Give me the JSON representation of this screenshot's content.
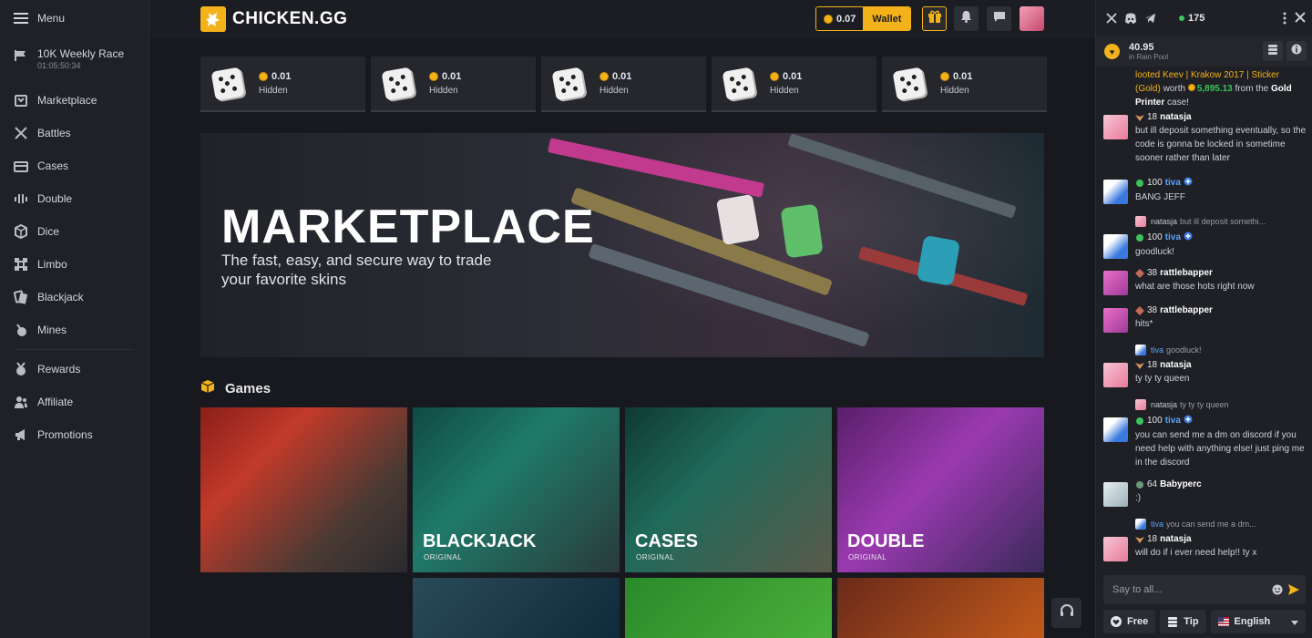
{
  "sidebar": {
    "menu_label": "Menu",
    "race": {
      "title": "10K Weekly Race",
      "timer": "01:05:50:34"
    },
    "nav": [
      {
        "label": "Marketplace",
        "icon": "store-icon"
      },
      {
        "label": "Battles",
        "icon": "swords-icon"
      },
      {
        "label": "Cases",
        "icon": "case-icon"
      },
      {
        "label": "Double",
        "icon": "bars-icon"
      },
      {
        "label": "Dice",
        "icon": "cube-icon"
      },
      {
        "label": "Limbo",
        "icon": "limbo-icon"
      },
      {
        "label": "Blackjack",
        "icon": "cards-icon"
      },
      {
        "label": "Mines",
        "icon": "mine-icon"
      }
    ],
    "secondary": [
      {
        "label": "Rewards",
        "icon": "medal-icon"
      },
      {
        "label": "Affiliate",
        "icon": "users-icon"
      },
      {
        "label": "Promotions",
        "icon": "megaphone-icon"
      }
    ]
  },
  "header": {
    "brand": "CHICKEN.GG",
    "balance": "0.07",
    "wallet_label": "Wallet",
    "accent": "#f3b21a"
  },
  "drops": [
    {
      "value": "0.01",
      "label": "Hidden"
    },
    {
      "value": "0.01",
      "label": "Hidden"
    },
    {
      "value": "0.01",
      "label": "Hidden"
    },
    {
      "value": "0.01",
      "label": "Hidden"
    },
    {
      "value": "0.01",
      "label": "Hidden"
    }
  ],
  "banner": {
    "title": "MARKETPLACE",
    "subtitle": "The fast, easy, and secure way to trade your favorite skins"
  },
  "games": {
    "heading": "Games",
    "tiles": [
      {
        "title": "",
        "tag": ""
      },
      {
        "title": "BLACKJACK",
        "tag": "ORIGINAL"
      },
      {
        "title": "CASES",
        "tag": "ORIGINAL"
      },
      {
        "title": "DOUBLE",
        "tag": "ORIGINAL"
      }
    ]
  },
  "chat": {
    "online_count": "175",
    "rain": {
      "amount": "40.95",
      "label": "in Rain Pool"
    },
    "top_partial": {
      "line1": "looted Keev | Krakow 2017 | Sticker",
      "line2a": "(Gold)",
      "line2b": " worth ",
      "amount": "5,895.13",
      "line2c": " from the ",
      "line2d": "Gold",
      "line3": "Printer",
      "line3b": " case!"
    },
    "messages": [
      {
        "level": "18",
        "name": "natasja",
        "text": "but ill deposit something eventually, so the code is gonna be locked in sometime sooner rather than later"
      },
      {
        "level": "100",
        "name": "tiva",
        "text": "BANG JEFF"
      },
      {
        "reply_name": "natasja",
        "reply_text": "but ill deposit somethi..."
      },
      {
        "level": "100",
        "name": "tiva",
        "text": "goodluck!"
      },
      {
        "level": "38",
        "name": "rattlebapper",
        "text": "what are those hots right now"
      },
      {
        "level": "38",
        "name": "rattlebapper",
        "text": "hits*"
      },
      {
        "reply_name": "tiva",
        "reply_text": "goodluck!"
      },
      {
        "level": "18",
        "name": "natasja",
        "text": "ty ty ty queen"
      },
      {
        "reply_name": "natasja",
        "reply_text": "ty ty ty queen"
      },
      {
        "level": "100",
        "name": "tiva",
        "text": "you can send me a dm on discord if you need help with anything else! just ping me in the discord"
      },
      {
        "level": "64",
        "name": "Babyperc",
        "text": ":)"
      },
      {
        "reply_name": "tiva",
        "reply_text": "you can send me a dm..."
      },
      {
        "level": "18",
        "name": "natasja",
        "text": "will do if i ever need help!! ty x"
      }
    ],
    "input_placeholder": "Say to all...",
    "buttons": {
      "free": "Free",
      "tip": "Tip",
      "language": "English"
    }
  }
}
